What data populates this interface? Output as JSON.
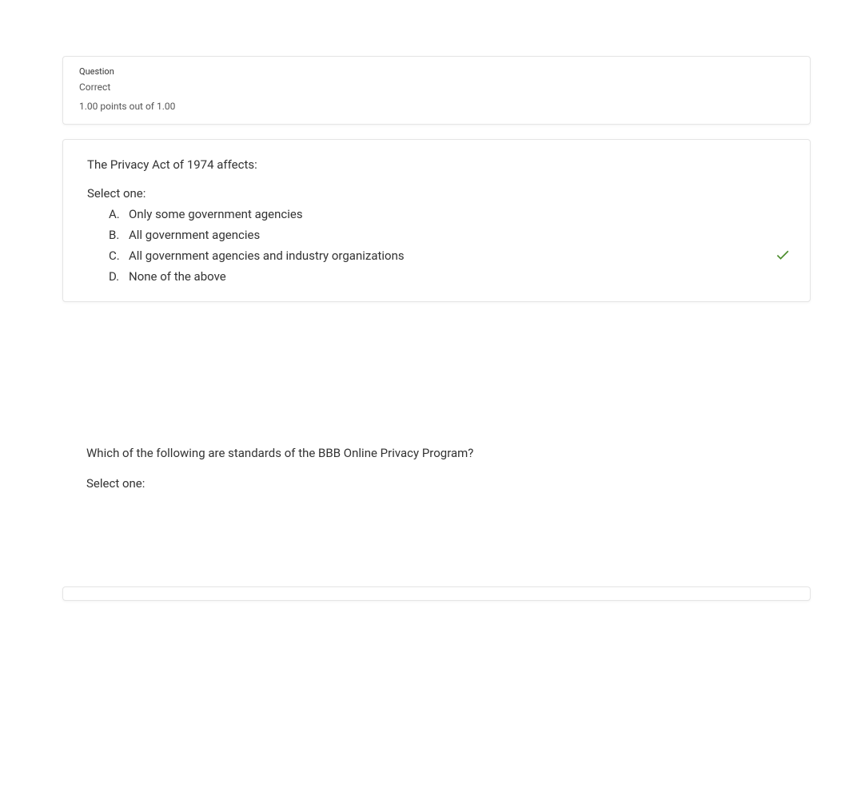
{
  "q1": {
    "label": "Question",
    "status": "Correct",
    "score": "1.00 points out of 1.00",
    "text": "The Privacy Act of 1974 affects:",
    "prompt": "Select one:",
    "options": [
      {
        "letter": "A.",
        "text": "Only some government agencies",
        "correct": false
      },
      {
        "letter": "B.",
        "text": "All government agencies",
        "correct": false
      },
      {
        "letter": "C.",
        "text": "All government agencies and industry organizations",
        "correct": true
      },
      {
        "letter": "D.",
        "text": "None of the above",
        "correct": false
      }
    ]
  },
  "q2": {
    "text": "Which of the following are standards of the BBB Online Privacy Program?",
    "prompt": "Select one:"
  }
}
